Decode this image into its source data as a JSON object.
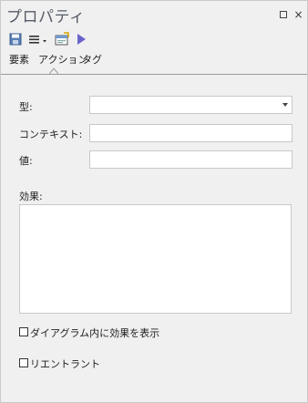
{
  "window": {
    "title": "プロパティ",
    "restore_icon": "restore-window-icon",
    "close_glyph": "×"
  },
  "toolbar": {
    "icons": [
      "save-icon",
      "menu-icon",
      "properties-icon",
      "run-icon"
    ],
    "colors": {
      "save": "#5b7fb5",
      "run": "#6b63c9"
    }
  },
  "tabs": [
    {
      "label": "要素",
      "active": false
    },
    {
      "label": "アクション",
      "active": true
    },
    {
      "label": "タグ",
      "active": false
    }
  ],
  "form": {
    "type_label": "型:",
    "type_value": "",
    "context_label": "コンテキスト:",
    "context_value": "",
    "value_label": "値:",
    "value_value": "",
    "effect_label": "効果:",
    "effect_value": ""
  },
  "options": {
    "show_effect_label": "ダイアグラム内に効果を表示",
    "show_effect_checked": false,
    "reentrant_label": "リエントラント",
    "reentrant_checked": false
  }
}
